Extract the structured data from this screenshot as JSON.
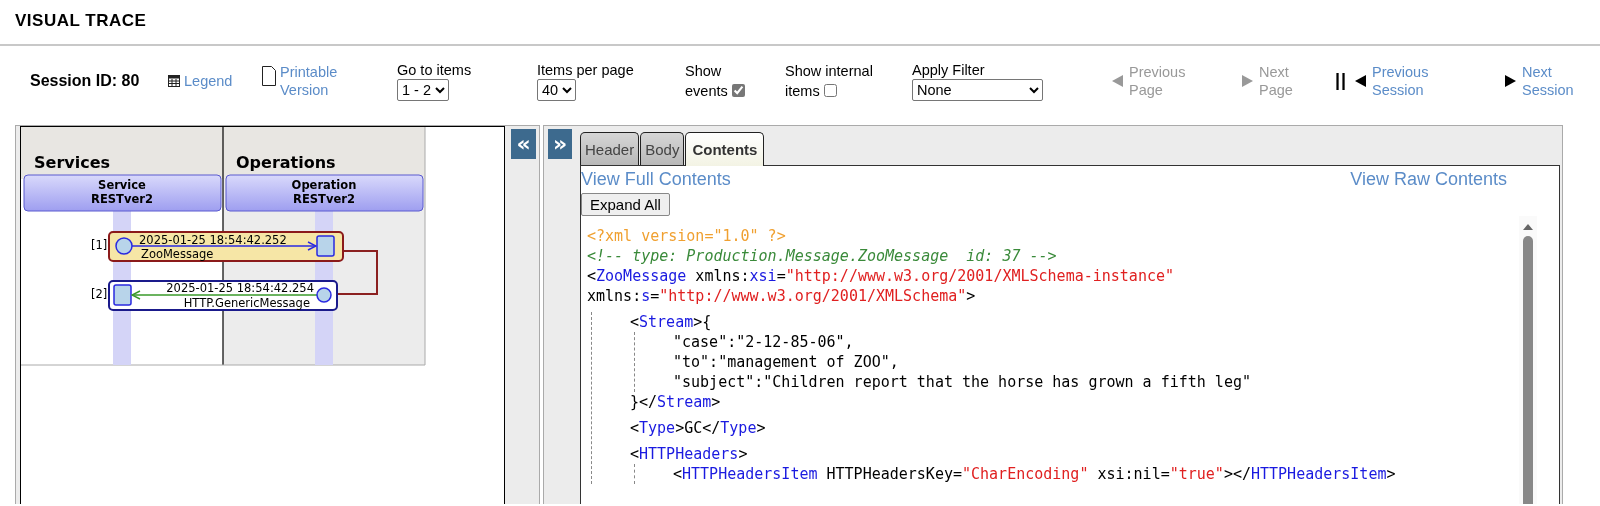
{
  "title": "VISUAL TRACE",
  "toolbar": {
    "items": [
      {
        "kind": "session",
        "label": "Session ID: 80"
      },
      {
        "kind": "legend",
        "label": "Legend"
      },
      {
        "kind": "printable",
        "label": "Printable Version"
      },
      {
        "kind": "select",
        "label": "Go to items",
        "value": "1 - 2"
      },
      {
        "kind": "select",
        "label": "Items per page",
        "value": "40"
      },
      {
        "kind": "check",
        "label": "Show events",
        "checked": true
      },
      {
        "kind": "check",
        "label": "Show internal items",
        "checked": false
      },
      {
        "kind": "select",
        "label": "Apply Filter",
        "value": "None"
      }
    ],
    "nav": [
      {
        "kind": "prev",
        "label": "Previous Page",
        "disabled": true
      },
      {
        "kind": "next",
        "label": "Next Page",
        "disabled": true
      },
      {
        "kind": "separator",
        "label": "||"
      },
      {
        "kind": "prev",
        "label": "Previous Session",
        "disabled": false
      },
      {
        "kind": "next",
        "label": "Next Session",
        "disabled": false
      }
    ]
  },
  "diagram": {
    "collapse": "«",
    "columns": [
      {
        "title": "Services",
        "actor": [
          "Service",
          "RESTver2"
        ]
      },
      {
        "title": "Operations",
        "actor": [
          "Operation",
          "RESTver2"
        ]
      }
    ],
    "messages": [
      {
        "index": "[1]",
        "time": "2025-01-25 18:54:42.252",
        "name": "ZooMessage",
        "kind": "request",
        "selected": true
      },
      {
        "index": "[2]",
        "time": "2025-01-25 18:54:42.254",
        "name": "HTTP.GenericMessage",
        "kind": "response",
        "selected": false
      }
    ]
  },
  "content": {
    "expand": "»",
    "tabs": [
      {
        "label": "Header",
        "selected": false
      },
      {
        "label": "Body",
        "selected": false
      },
      {
        "label": "Contents",
        "selected": true
      }
    ],
    "links": [
      "View Full Contents",
      "View Raw Contents"
    ],
    "button": "Expand All",
    "xml": [
      {
        "kind": "line",
        "tokens": [
          {
            "kind": "pi",
            "text": "<?xml version=\"1.0\" ?>"
          }
        ]
      },
      {
        "kind": "line",
        "tokens": [
          {
            "kind": "comment",
            "text": "<!-- type: Production.Message.ZooMessage  id: 37 -->"
          }
        ]
      },
      {
        "kind": "element",
        "open": [
          [
            {
              "kind": "p",
              "text": "<"
            },
            {
              "kind": "tag",
              "text": "ZooMessage"
            },
            {
              "kind": "attr",
              "text": " xmlns:"
            },
            {
              "kind": "ns",
              "text": "xsi"
            },
            {
              "kind": "p",
              "text": "="
            },
            {
              "kind": "val",
              "text": "\"http://www.w3.org/2001/XMLSchema-instance\""
            }
          ],
          [
            {
              "kind": "attr",
              "text": "xmlns:"
            },
            {
              "kind": "ns",
              "text": "s"
            },
            {
              "kind": "p",
              "text": "="
            },
            {
              "kind": "val",
              "text": "\"http://www.w3.org/2001/XMLSchema\""
            },
            {
              "kind": "p",
              "text": ">"
            }
          ]
        ],
        "children": [
          {
            "kind": "element",
            "open": [
              [
                {
                  "kind": "p",
                  "text": "<"
                },
                {
                  "kind": "tag",
                  "text": "Stream"
                },
                {
                  "kind": "p",
                  "text": ">{"
                }
              ]
            ],
            "children": [
              {
                "kind": "line",
                "tokens": [
                  {
                    "kind": "text",
                    "text": "\"case\":\"2-12-85-06\","
                  }
                ]
              },
              {
                "kind": "line",
                "tokens": [
                  {
                    "kind": "text",
                    "text": "\"to\":\"management of ZOO\","
                  }
                ]
              },
              {
                "kind": "line",
                "tokens": [
                  {
                    "kind": "text",
                    "text": "\"subject\":\"Children report that the horse has grown a fifth leg\""
                  }
                ]
              }
            ],
            "close": [
              {
                "kind": "p",
                "text": "}</"
              },
              {
                "kind": "tag",
                "text": "Stream"
              },
              {
                "kind": "p",
                "text": ">"
              }
            ]
          },
          {
            "kind": "element",
            "open": [
              [
                {
                  "kind": "p",
                  "text": "<"
                },
                {
                  "kind": "tag",
                  "text": "Type"
                },
                {
                  "kind": "p",
                  "text": ">GC</"
                },
                {
                  "kind": "tag",
                  "text": "Type"
                },
                {
                  "kind": "p",
                  "text": ">"
                }
              ]
            ]
          },
          {
            "kind": "element",
            "open": [
              [
                {
                  "kind": "p",
                  "text": "<"
                },
                {
                  "kind": "tag",
                  "text": "HTTPHeaders"
                },
                {
                  "kind": "p",
                  "text": ">"
                }
              ]
            ],
            "children": [
              {
                "kind": "line",
                "tokens": [
                  {
                    "kind": "p",
                    "text": "<"
                  },
                  {
                    "kind": "tag",
                    "text": "HTTPHeadersItem"
                  },
                  {
                    "kind": "attr",
                    "text": " HTTPHeadersKey="
                  },
                  {
                    "kind": "val",
                    "text": "\"CharEncoding\""
                  },
                  {
                    "kind": "attr",
                    "text": " xsi:nil="
                  },
                  {
                    "kind": "val",
                    "text": "\"true\""
                  },
                  {
                    "kind": "p",
                    "text": "></"
                  },
                  {
                    "kind": "tag",
                    "text": "HTTPHeadersItem"
                  },
                  {
                    "kind": "p",
                    "text": ">"
                  }
                ]
              }
            ]
          }
        ]
      }
    ]
  }
}
